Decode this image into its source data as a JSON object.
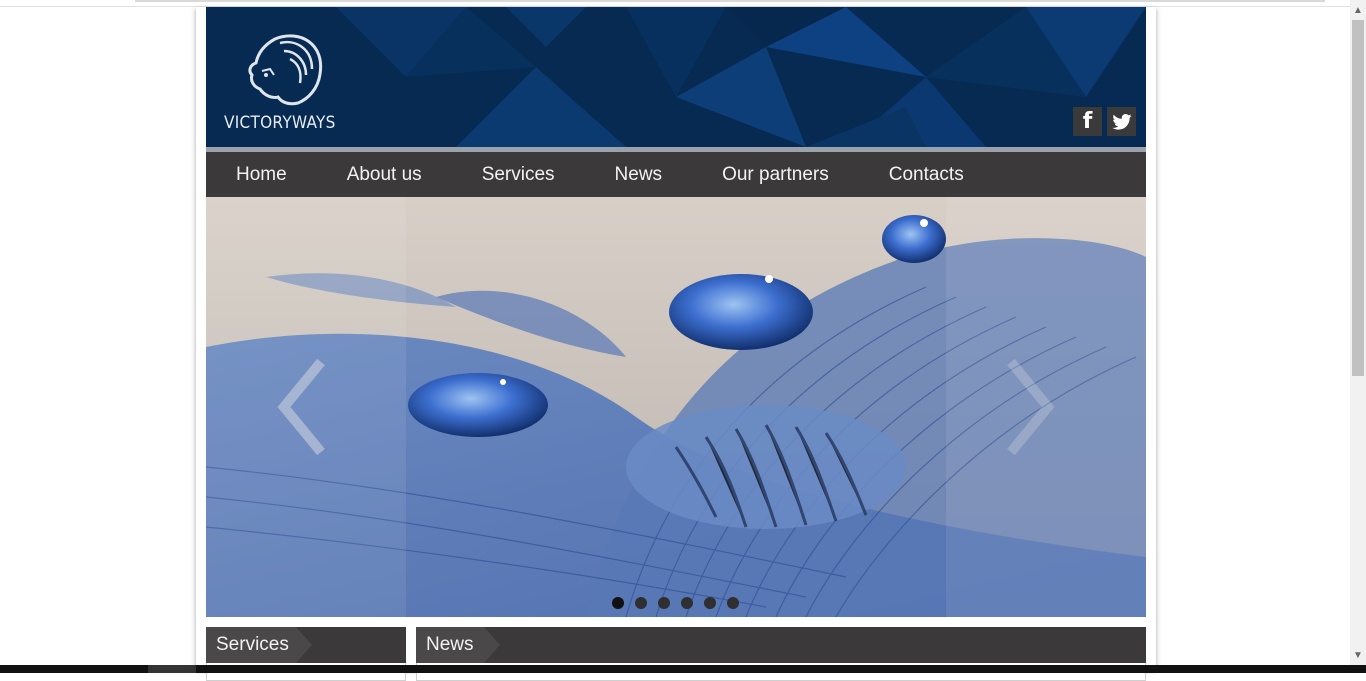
{
  "header": {
    "brand": "VICTORYWAYS",
    "social": [
      {
        "name": "facebook",
        "icon": "facebook-icon",
        "glyph": "f"
      },
      {
        "name": "twitter",
        "icon": "twitter-icon"
      }
    ]
  },
  "nav": {
    "items": [
      {
        "label": "Home"
      },
      {
        "label": "About us"
      },
      {
        "label": "Services"
      },
      {
        "label": "News"
      },
      {
        "label": "Our partners"
      },
      {
        "label": "Contacts"
      }
    ]
  },
  "slider": {
    "prev_icon": "chevron-left-icon",
    "next_icon": "chevron-right-icon",
    "slide_count": 6,
    "active_slide": 1
  },
  "sections": {
    "services_title": "Services",
    "news_title": "News"
  },
  "colors": {
    "header_bg": "#062a52",
    "nav_bg": "#3b393a",
    "accent_blue": "#3d63b0"
  }
}
